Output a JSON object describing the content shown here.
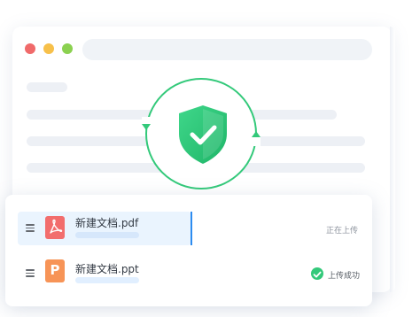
{
  "colors": {
    "accent_green": "#33c97a",
    "accent_blue": "#2d8cf0",
    "pdf_red": "#f26d6d",
    "ppt_orange": "#f79457"
  },
  "window_controls": [
    "close-dot",
    "minimize-dot",
    "maximize-dot"
  ],
  "security": {
    "icon": "shield-check-icon",
    "sync_arrows": "refresh-arrows-icon"
  },
  "files": [
    {
      "name": "新建文档.pdf",
      "icon": "pdf-file-icon",
      "status": "正在上传",
      "state": "uploading"
    },
    {
      "name": "新建文档.ppt",
      "icon": "ppt-file-icon",
      "icon_glyph": "P",
      "status": "上传成功",
      "state": "success"
    }
  ]
}
